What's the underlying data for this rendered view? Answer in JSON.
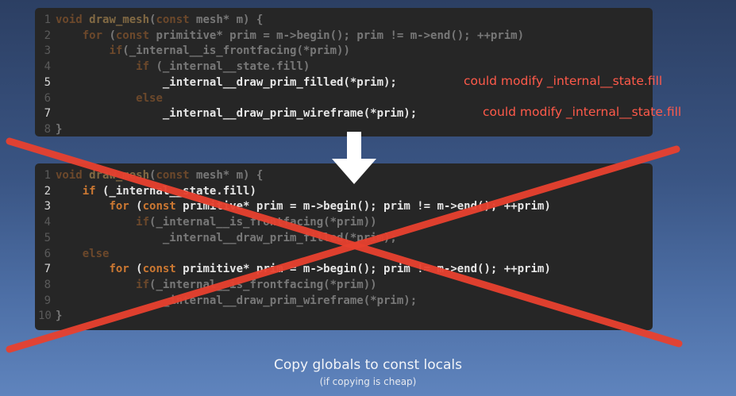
{
  "top_code": {
    "lines": [
      {
        "num": "1",
        "indent": "",
        "tokens": [
          {
            "t": "void ",
            "c": "kw"
          },
          {
            "t": "draw_mesh",
            "c": "fn"
          },
          {
            "t": "(",
            "c": "tx"
          },
          {
            "t": "const",
            "c": "kw"
          },
          {
            "t": " mesh* m) {",
            "c": "tx"
          }
        ]
      },
      {
        "num": "2",
        "indent": "    ",
        "tokens": [
          {
            "t": "for",
            "c": "kw"
          },
          {
            "t": " (",
            "c": "tx"
          },
          {
            "t": "const",
            "c": "kw"
          },
          {
            "t": " primitive* prim = m->begin(); prim != m->end(); ++prim)",
            "c": "tx"
          }
        ]
      },
      {
        "num": "3",
        "indent": "        ",
        "tokens": [
          {
            "t": "if",
            "c": "kw"
          },
          {
            "t": "(_internal__is_frontfacing(*prim))",
            "c": "tx"
          }
        ]
      },
      {
        "num": "4",
        "indent": "            ",
        "tokens": [
          {
            "t": "if",
            "c": "kw"
          },
          {
            "t": " (_internal__state.fill)",
            "c": "tx"
          }
        ]
      },
      {
        "num": "5",
        "indent": "                ",
        "tokens": [
          {
            "t": "_internal__draw_prim_filled(*prim);",
            "c": "tx"
          }
        ]
      },
      {
        "num": "6",
        "indent": "            ",
        "tokens": [
          {
            "t": "else",
            "c": "kw"
          }
        ]
      },
      {
        "num": "7",
        "indent": "                ",
        "tokens": [
          {
            "t": "_internal__draw_prim_wireframe(*prim);",
            "c": "tx"
          }
        ]
      },
      {
        "num": "8",
        "indent": "",
        "tokens": [
          {
            "t": "}",
            "c": "tx"
          }
        ]
      }
    ],
    "active_lines": [
      "5",
      "7"
    ]
  },
  "notes": {
    "line5": "could modify _internal__state.fill",
    "line7": "could modify _internal__state.fill"
  },
  "bottom_code": {
    "lines": [
      {
        "num": "1",
        "indent": "",
        "tokens": [
          {
            "t": "void ",
            "c": "kw"
          },
          {
            "t": "draw_mesh",
            "c": "fn"
          },
          {
            "t": "(",
            "c": "tx"
          },
          {
            "t": "const",
            "c": "kw"
          },
          {
            "t": " mesh* m) {",
            "c": "tx"
          }
        ]
      },
      {
        "num": "2",
        "indent": "    ",
        "tokens": [
          {
            "t": "if",
            "c": "kw"
          },
          {
            "t": " (_internal__state.fill)",
            "c": "tx"
          }
        ]
      },
      {
        "num": "3",
        "indent": "        ",
        "tokens": [
          {
            "t": "for",
            "c": "kw"
          },
          {
            "t": " (",
            "c": "tx"
          },
          {
            "t": "const",
            "c": "kw"
          },
          {
            "t": " primitive* prim = m->begin(); prim != m->end(); ++prim)",
            "c": "tx"
          }
        ]
      },
      {
        "num": "4",
        "indent": "            ",
        "tokens": [
          {
            "t": "if",
            "c": "kw"
          },
          {
            "t": "(_internal__is_frontfacing(*prim))",
            "c": "tx"
          }
        ]
      },
      {
        "num": "5",
        "indent": "                ",
        "tokens": [
          {
            "t": "_internal__draw_prim_filled(*prim);",
            "c": "tx"
          }
        ]
      },
      {
        "num": "6",
        "indent": "    ",
        "tokens": [
          {
            "t": "else",
            "c": "kw"
          }
        ]
      },
      {
        "num": "7",
        "indent": "        ",
        "tokens": [
          {
            "t": "for",
            "c": "kw"
          },
          {
            "t": " (",
            "c": "tx"
          },
          {
            "t": "const",
            "c": "kw"
          },
          {
            "t": " primitive* prim = m->begin(); prim != m->end(); ++prim)",
            "c": "tx"
          }
        ]
      },
      {
        "num": "8",
        "indent": "            ",
        "tokens": [
          {
            "t": "if",
            "c": "kw"
          },
          {
            "t": "(_internal__is_frontfacing(*prim))",
            "c": "tx"
          }
        ]
      },
      {
        "num": "9",
        "indent": "                ",
        "tokens": [
          {
            "t": "_internal__draw_prim_wireframe(*prim);",
            "c": "tx"
          }
        ]
      },
      {
        "num": "10",
        "indent": "",
        "tokens": [
          {
            "t": "}",
            "c": "tx"
          }
        ]
      }
    ],
    "active_lines": [
      "2",
      "3",
      "7"
    ]
  },
  "caption": {
    "main": "Copy globals to const locals",
    "sub": "(if copying is cheap)"
  },
  "icons": {
    "transition": "arrow-down-icon",
    "rejection": "cross-out-icon"
  },
  "colors": {
    "keyword": "#cc7832",
    "function": "#ffc66d",
    "text": "#e6e6e6",
    "note": "#ff5a4a",
    "cross": "#e8412f",
    "arrow": "#ffffff"
  }
}
